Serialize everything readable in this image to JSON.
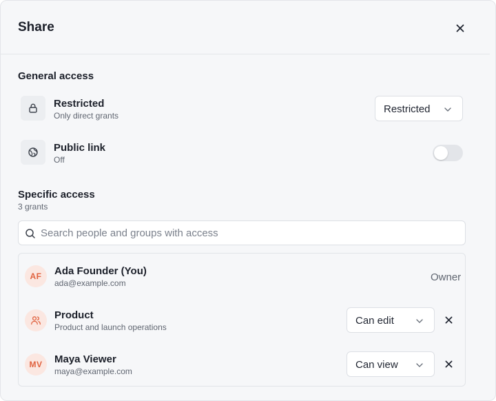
{
  "dialog": {
    "title": "Share"
  },
  "general_access": {
    "heading": "General access",
    "restricted": {
      "title": "Restricted",
      "subtitle": "Only direct grants",
      "select_value": "Restricted"
    },
    "public_link": {
      "title": "Public link",
      "subtitle": "Off",
      "enabled": false
    }
  },
  "specific_access": {
    "heading": "Specific access",
    "count_label": "3 grants",
    "search": {
      "placeholder": "Search people and groups with access",
      "value": ""
    },
    "grants": [
      {
        "initials": "AF",
        "name": "Ada Founder (You)",
        "detail": "ada@example.com",
        "role": "Owner"
      },
      {
        "icon": "users-icon",
        "name": "Product",
        "detail": "Product and launch operations",
        "role": "Can edit"
      },
      {
        "initials": "MV",
        "name": "Maya Viewer",
        "detail": "maya@example.com",
        "role": "Can view"
      }
    ]
  },
  "colors": {
    "accent_avatar_bg": "#fbe7e1",
    "accent_avatar_fg": "#e0623f",
    "surface": "#f6f7f9"
  }
}
